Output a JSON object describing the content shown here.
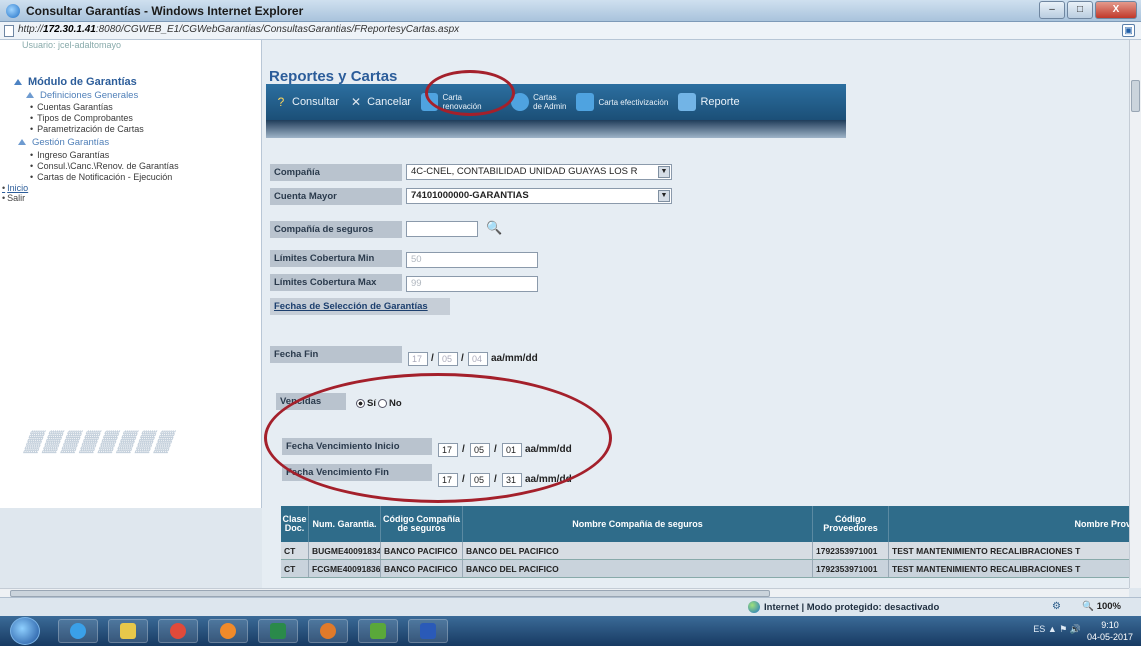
{
  "window": {
    "title": "Consultar Garantías - Windows Internet Explorer",
    "minimize": "–",
    "maximize": "□",
    "close": "X"
  },
  "address": {
    "url_prefix": "http://",
    "url_host": "172.30.1.41",
    "url_rest": ":8080/CGWEB_E1/CGWebGarantias/ConsultasGarantias/FReportesyCartas.aspx"
  },
  "sidebar": {
    "cropped_top": "Usuario: jcel-adaltomayo",
    "section_title": "Módulo de Garantías",
    "groups": [
      {
        "label": "Definiciones Generales",
        "items": [
          "Cuentas Garantías",
          "Tipos de Comprobantes",
          "Parametrización de Cartas"
        ]
      },
      {
        "label": "Gestión Garantías",
        "items": [
          "Ingreso Garantías",
          "Consul.\\Canc.\\Renov. de Garantías",
          "Cartas de Notificación - Ejecución"
        ]
      }
    ],
    "root_links": [
      "Inicio",
      "Salir"
    ]
  },
  "page": {
    "title": "Reportes y Cartas"
  },
  "toolbar": {
    "consultar": "Consultar",
    "cancelar": "Cancelar",
    "carta_renovacion": "Carta renovación",
    "cartas_admin_line1": "Cartas",
    "cartas_admin_line2": "de Admin",
    "carta_efectivizacion": "Carta efectivización",
    "reporte": "Reporte"
  },
  "form": {
    "compania_label": "Compañía",
    "compania_value": "4C-CNEL, CONTABILIDAD UNIDAD GUAYAS LOS R",
    "cuenta_label": "Cuenta Mayor",
    "cuenta_value": "74101000000-GARANTIAS",
    "aseguradora_label": "Compañía de seguros",
    "aseguradora_value": "",
    "limite_min_label": "Límites Cobertura Min",
    "limite_min_value": "50",
    "limite_max_label": "Límites Cobertura Max",
    "limite_max_value": "99",
    "fechas_link": "Fechas de Selección de Garantías",
    "fecha_fin_label": "Fecha Fin",
    "fecha_fin_yy": "17",
    "fecha_fin_mm": "05",
    "fecha_fin_dd": "04",
    "date_format": "aa/mm/dd",
    "vencidas_label": "Vencidas",
    "vencidas_si": "Sí",
    "vencidas_no": "No",
    "venc_inicio_label": "Fecha Vencimiento Inicio",
    "venc_inicio_yy": "17",
    "venc_inicio_mm": "05",
    "venc_inicio_dd": "01",
    "venc_fin_label": "Fecha Vencimiento Fin",
    "venc_fin_yy": "17",
    "venc_fin_mm": "05",
    "venc_fin_dd": "31",
    "slash": "/"
  },
  "grid": {
    "headers": [
      "Clase Doc.",
      "Num. Garantia.",
      "Código Compañía de seguros",
      "Nombre Compañía de seguros",
      "Código Proveedores",
      "Nombre Prove"
    ],
    "rows": [
      [
        "CT",
        "BUGME40091834",
        "BANCO PACIFICO",
        "BANCO DEL PACIFICO",
        "1792353971001",
        "TEST MANTENIMIENTO RECALIBRACIONES T"
      ],
      [
        "CT",
        "FCGME40091836",
        "BANCO PACIFICO",
        "BANCO DEL PACIFICO",
        "1792353971001",
        "TEST MANTENIMIENTO RECALIBRACIONES T"
      ]
    ]
  },
  "status": {
    "zone": "Internet | Modo protegido: desactivado",
    "zoom": "100%"
  },
  "taskbar": {
    "lang": "ES",
    "time": "9:10",
    "date": "04-05-2017"
  }
}
